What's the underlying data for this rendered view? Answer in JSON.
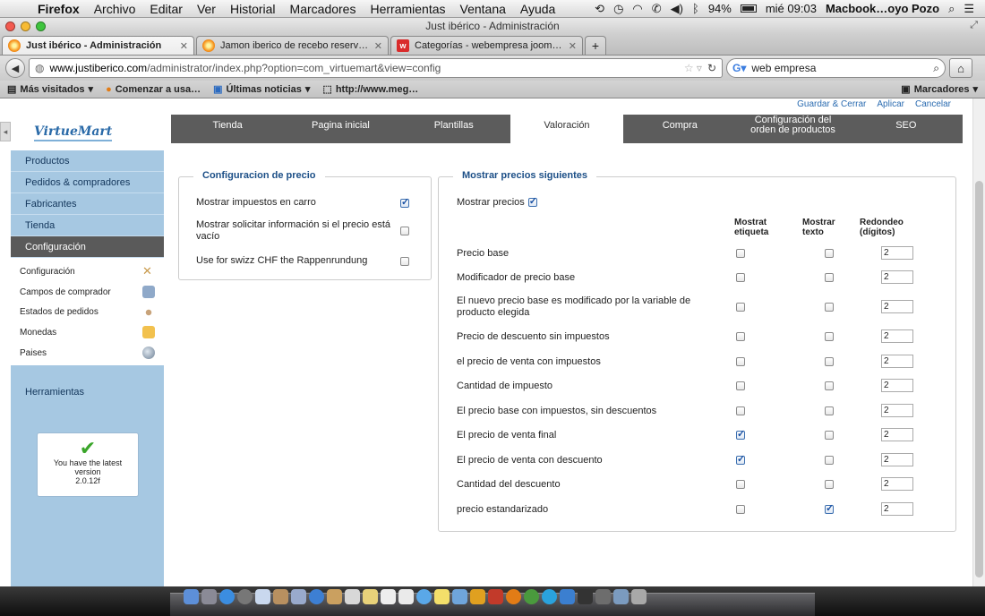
{
  "menubar": {
    "app": "Firefox",
    "items": [
      "Archivo",
      "Editar",
      "Ver",
      "Historial",
      "Marcadores",
      "Herramientas",
      "Ventana",
      "Ayuda"
    ],
    "battery": "94%",
    "clock": "mié 09:03",
    "user": "Macbook…oyo Pozo"
  },
  "window": {
    "title": "Just ibérico - Administración"
  },
  "tabs": [
    {
      "label": "Just ibérico - Administración",
      "active": true
    },
    {
      "label": "Jamon iberico de recebo reserv…",
      "active": false
    },
    {
      "label": "Categorías - webempresa joom…",
      "active": false
    }
  ],
  "navbar": {
    "url_host": "www.justiberico.com",
    "url_path": "/administrator/index.php?option=com_virtuemart&view=config",
    "search_value": "web empresa"
  },
  "bookmarks": {
    "items": [
      "Más visitados",
      "Comenzar a usa…",
      "Últimas noticias",
      "http://www.meg…"
    ],
    "right": "Marcadores"
  },
  "top_actions": [
    "Guardar & Cerrar",
    "Aplicar",
    "Cancelar"
  ],
  "sidebar": {
    "logo": "VirtueMart",
    "nav": [
      "Productos",
      "Pedidos & compradores",
      "Fabricantes",
      "Tienda",
      "Configuración"
    ],
    "active_nav": "Configuración",
    "sub": [
      "Configuración",
      "Campos de comprador",
      "Estados de pedidos",
      "Monedas",
      "Paises"
    ],
    "tools": "Herramientas",
    "version_line1": "You have the latest",
    "version_line2": "version",
    "version_line3": "2.0.12f"
  },
  "content_tabs": [
    "Tienda",
    "Pagina inicial",
    "Plantillas",
    "Valoración",
    "Compra",
    "Configuración del orden de productos",
    "SEO"
  ],
  "content_tab_line1": "Configuración del",
  "content_tab_line2": "orden de productos",
  "price_config": {
    "legend": "Configuracion de precio",
    "rows": [
      {
        "label": "Mostrar impuestos en carro",
        "checked": true
      },
      {
        "label": "Mostrar solicitar información si el precio está vacío",
        "checked": false
      },
      {
        "label": "Use for swizz CHF the Rappenrundung",
        "checked": false
      }
    ]
  },
  "show_prices": {
    "legend": "Mostrar precios siguientes",
    "show_label": "Mostrar precios",
    "show_checked": true,
    "col1_line1": "Mostrat",
    "col1_line2": "etiqueta",
    "col2_line1": "Mostrar",
    "col2_line2": "texto",
    "col3_line1": "Redondeo",
    "col3_line2": "(dígitos)",
    "rows": [
      {
        "label": "Precio base",
        "label_checked": false,
        "text_checked": false,
        "rounding": "2"
      },
      {
        "label": "Modificador de precio base",
        "label_checked": false,
        "text_checked": false,
        "rounding": "2"
      },
      {
        "label": "El nuevo precio base es modificado por la variable de producto elegida",
        "label_checked": false,
        "text_checked": false,
        "rounding": "2"
      },
      {
        "label": "Precio de descuento sin impuestos",
        "label_checked": false,
        "text_checked": false,
        "rounding": "2"
      },
      {
        "label": "el precio de venta con impuestos",
        "label_checked": false,
        "text_checked": false,
        "rounding": "2"
      },
      {
        "label": "Cantidad de impuesto",
        "label_checked": false,
        "text_checked": false,
        "rounding": "2"
      },
      {
        "label": "El precio base con impuestos, sin descuentos",
        "label_checked": false,
        "text_checked": false,
        "rounding": "2"
      },
      {
        "label": "El precio de venta final",
        "label_checked": true,
        "text_checked": false,
        "rounding": "2"
      },
      {
        "label": "El precio de venta con descuento",
        "label_checked": true,
        "text_checked": false,
        "rounding": "2"
      },
      {
        "label": "Cantidad del descuento",
        "label_checked": false,
        "text_checked": false,
        "rounding": "2"
      },
      {
        "label": "precio estandarizado",
        "label_checked": false,
        "text_checked": true,
        "rounding": "2"
      }
    ]
  },
  "colors": {
    "sidebar_bg": "#a6c8e2",
    "tabs_bg": "#5c5c5c",
    "legend_blue": "#1c4f87",
    "link_blue": "#2a6bb0"
  }
}
